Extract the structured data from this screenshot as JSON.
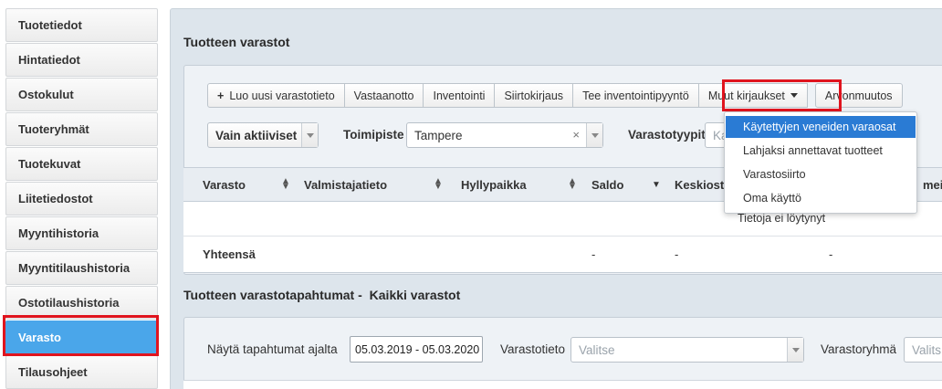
{
  "sidebar": {
    "items": [
      {
        "label": "Tuotetiedot"
      },
      {
        "label": "Hintatiedot"
      },
      {
        "label": "Ostokulut"
      },
      {
        "label": "Tuoteryhmät"
      },
      {
        "label": "Tuotekuvat"
      },
      {
        "label": "Liitetiedostot"
      },
      {
        "label": "Myyntihistoria"
      },
      {
        "label": "Myyntitilaushistoria"
      },
      {
        "label": "Ostotilaushistoria"
      },
      {
        "label": "Varasto"
      },
      {
        "label": "Tilausohjeet"
      }
    ]
  },
  "stock": {
    "title": "Tuotteen varastot",
    "toolbar": {
      "new_label": "Luo uusi varastotieto",
      "receive_label": "Vastaanotto",
      "inventory_label": "Inventointi",
      "transfer_label": "Siirtokirjaus",
      "inventory_request_label": "Tee inventointipyyntö",
      "other_label": "Muut kirjaukset",
      "value_change_label": "Arvonmuutos"
    },
    "filters": {
      "active_value": "Vain aktiiviset",
      "office_label": "Toimipiste",
      "office_value": "Tampere",
      "types_label": "Varastotyypit",
      "types_placeholder": "Ka"
    },
    "table": {
      "headers": [
        "Varasto",
        "Valmistajatieto",
        "Hyllypaikka",
        "Saldo",
        "Keskiost",
        "meir"
      ],
      "empty_text": "Tietoja ei löytynyt",
      "total_label": "Yhteensä",
      "total_values": [
        "-",
        "-",
        "-"
      ]
    },
    "dropdown": {
      "items": [
        {
          "label": "Käytettyjen veneiden varaosat"
        },
        {
          "label": "Lahjaksi annettavat tuotteet"
        },
        {
          "label": "Varastosiirto"
        },
        {
          "label": "Oma käyttö"
        }
      ]
    }
  },
  "transactions": {
    "title_main": "Tuotteen varastotapahtumat -",
    "title_scope": "Kaikki varastot",
    "period_label": "Näytä tapahtumat ajalta",
    "period_value": "05.03.2019 - 05.03.2020",
    "stock_info_label": "Varastotieto",
    "stock_info_placeholder": "Valitse",
    "stock_group_label": "Varastoryhmä",
    "stock_group_placeholder": "Valits"
  },
  "colors": {
    "active_tab": "#4aa6ea",
    "highlight": "#e0141e",
    "dropdown_active": "#2a7bd4"
  }
}
